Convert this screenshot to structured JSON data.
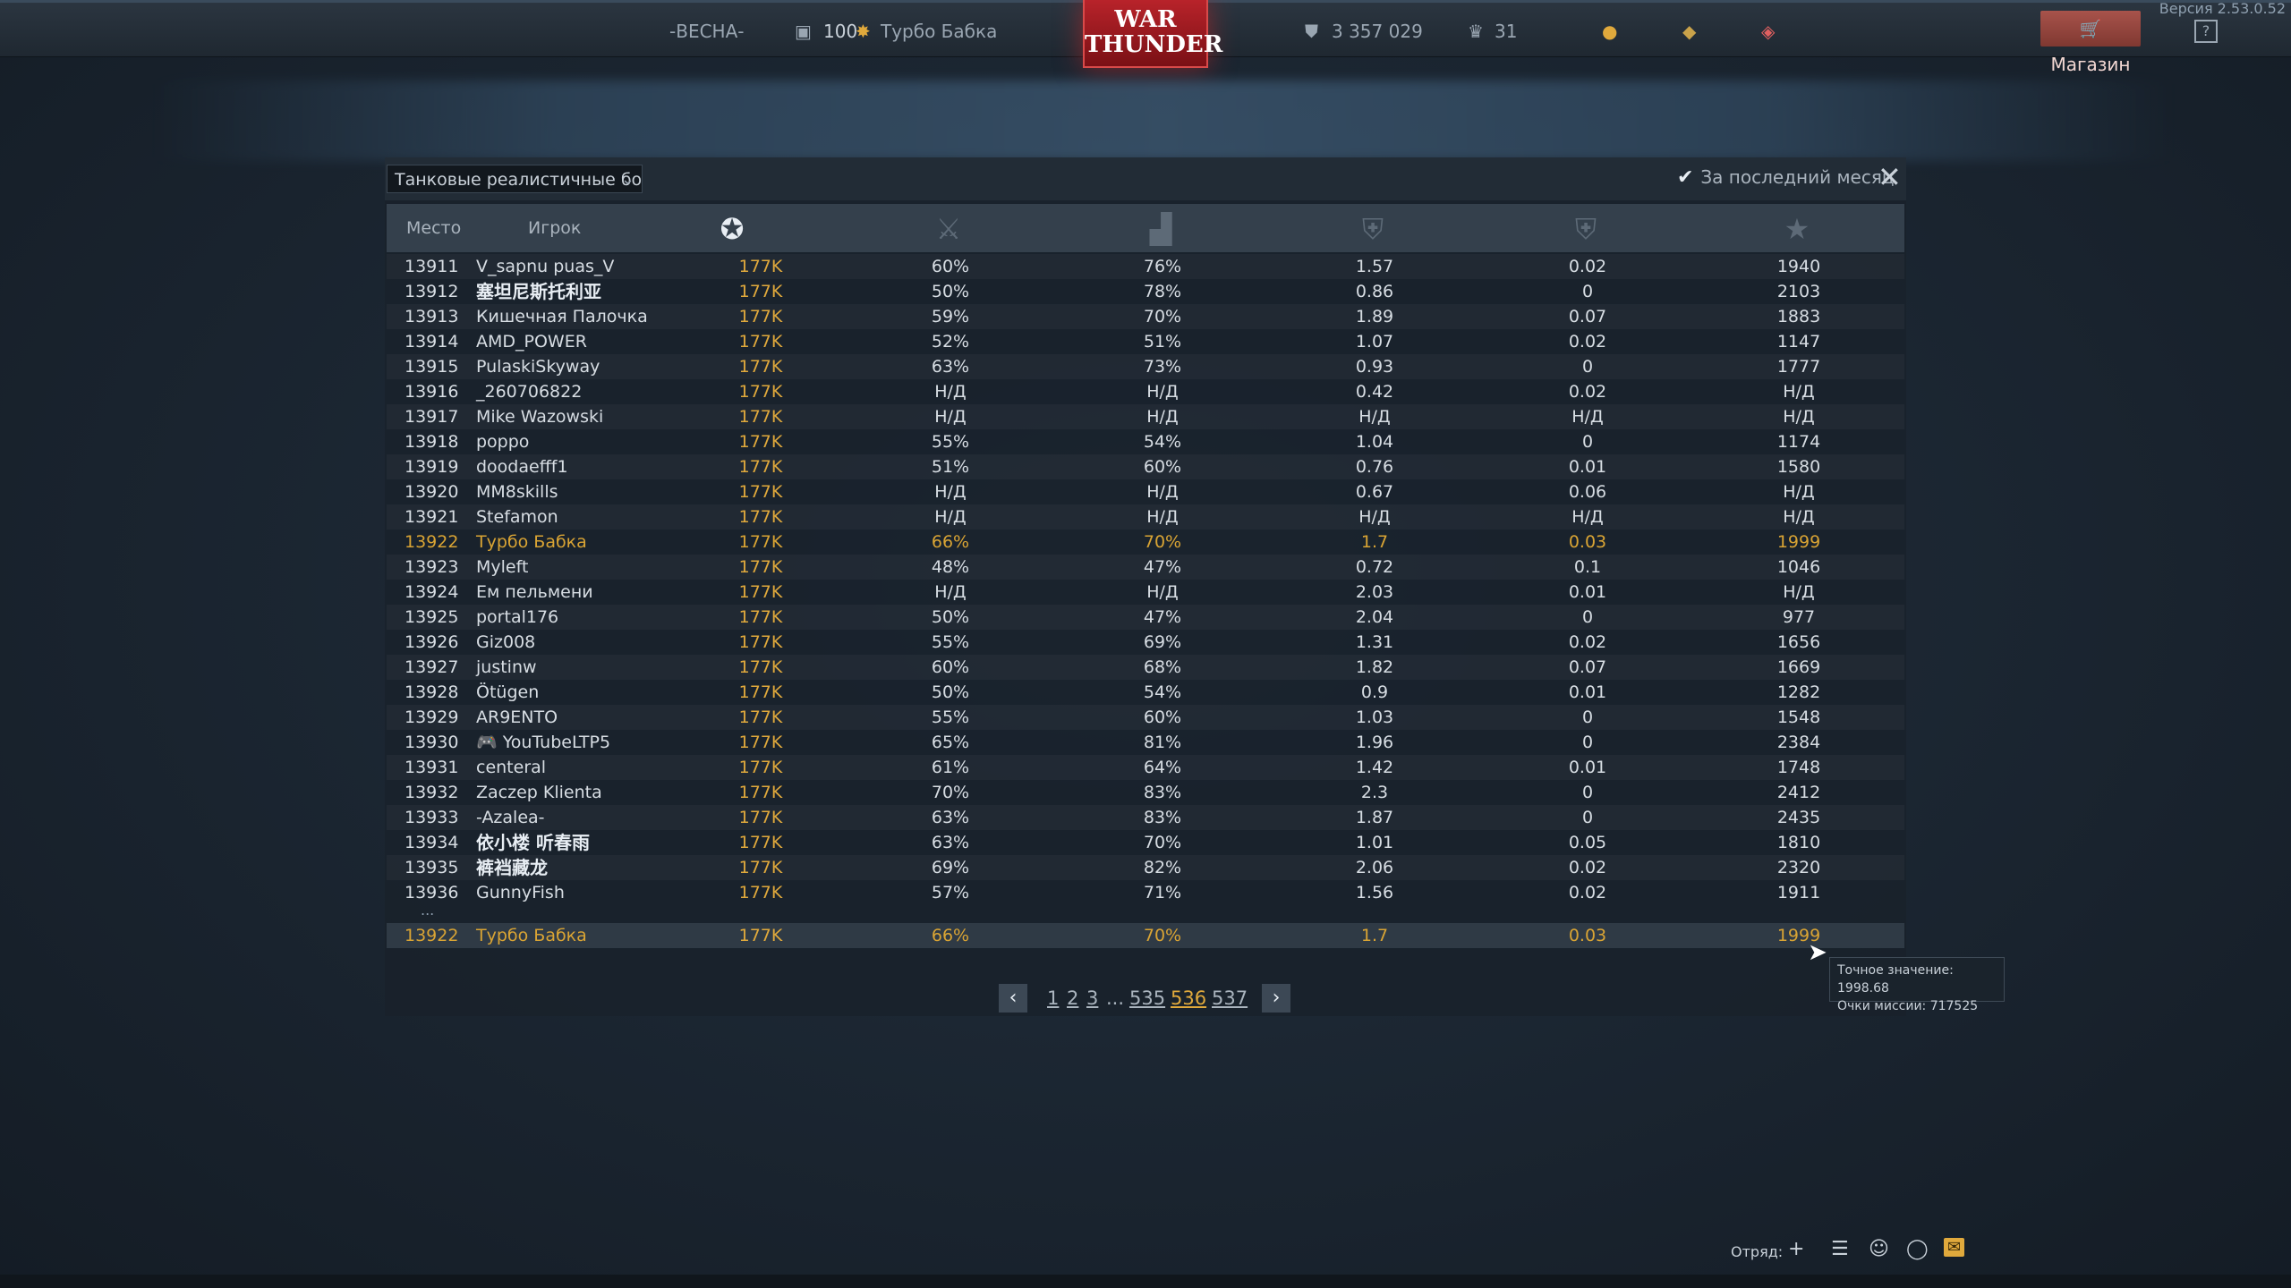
{
  "topbar": {
    "season": "-ВЕСНА-",
    "level": "100",
    "player_name": "Турбо  Бабка",
    "logo_line1": "WAR",
    "logo_line2": "THUNDER",
    "silver_lions": "3 357 029",
    "golden_eagles": "31",
    "shop_label": "Магазин",
    "help_label": "?",
    "version": "Версия 2.53.0.52"
  },
  "leaderboard": {
    "mode_select": "Танковые реалистичные бои",
    "last_month_label": "За последний месяц",
    "columns": {
      "place": "Место",
      "player": "Игрок"
    },
    "rows": [
      {
        "rank": "13911",
        "name": "V_sapnu puas_V",
        "rating": "177K",
        "v1": "60%",
        "v2": "76%",
        "v3": "1.57",
        "v4": "0.02",
        "v5": "1940"
      },
      {
        "rank": "13912",
        "name": "塞坦尼斯托利亚",
        "rating": "177K",
        "v1": "50%",
        "v2": "78%",
        "v3": "0.86",
        "v4": "0",
        "v5": "2103",
        "cjk": true
      },
      {
        "rank": "13913",
        "name": "Кишечная Палочка",
        "rating": "177K",
        "v1": "59%",
        "v2": "70%",
        "v3": "1.89",
        "v4": "0.07",
        "v5": "1883"
      },
      {
        "rank": "13914",
        "name": "AMD_POWER",
        "rating": "177K",
        "v1": "52%",
        "v2": "51%",
        "v3": "1.07",
        "v4": "0.02",
        "v5": "1147"
      },
      {
        "rank": "13915",
        "name": "PulaskiSkyway",
        "rating": "177K",
        "v1": "63%",
        "v2": "73%",
        "v3": "0.93",
        "v4": "0",
        "v5": "1777"
      },
      {
        "rank": "13916",
        "name": "_260706822",
        "rating": "177K",
        "v1": "Н/Д",
        "v2": "Н/Д",
        "v3": "0.42",
        "v4": "0.02",
        "v5": "Н/Д"
      },
      {
        "rank": "13917",
        "name": "Mike Wazowski",
        "rating": "177K",
        "v1": "Н/Д",
        "v2": "Н/Д",
        "v3": "Н/Д",
        "v4": "Н/Д",
        "v5": "Н/Д"
      },
      {
        "rank": "13918",
        "name": "poppo",
        "rating": "177K",
        "v1": "55%",
        "v2": "54%",
        "v3": "1.04",
        "v4": "0",
        "v5": "1174"
      },
      {
        "rank": "13919",
        "name": "doodaefff1",
        "rating": "177K",
        "v1": "51%",
        "v2": "60%",
        "v3": "0.76",
        "v4": "0.01",
        "v5": "1580"
      },
      {
        "rank": "13920",
        "name": "MM8skills",
        "rating": "177K",
        "v1": "Н/Д",
        "v2": "Н/Д",
        "v3": "0.67",
        "v4": "0.06",
        "v5": "Н/Д"
      },
      {
        "rank": "13921",
        "name": "Stefamon",
        "rating": "177K",
        "v1": "Н/Д",
        "v2": "Н/Д",
        "v3": "Н/Д",
        "v4": "Н/Д",
        "v5": "Н/Д"
      },
      {
        "rank": "13922",
        "name": "Турбо  Бабка",
        "rating": "177K",
        "v1": "66%",
        "v2": "70%",
        "v3": "1.7",
        "v4": "0.03",
        "v5": "1999",
        "highlight": true
      },
      {
        "rank": "13923",
        "name": "Myleft",
        "rating": "177K",
        "v1": "48%",
        "v2": "47%",
        "v3": "0.72",
        "v4": "0.1",
        "v5": "1046"
      },
      {
        "rank": "13924",
        "name": "Ем пельмени",
        "rating": "177K",
        "v1": "Н/Д",
        "v2": "Н/Д",
        "v3": "2.03",
        "v4": "0.01",
        "v5": "Н/Д"
      },
      {
        "rank": "13925",
        "name": "portal176",
        "rating": "177K",
        "v1": "50%",
        "v2": "47%",
        "v3": "2.04",
        "v4": "0",
        "v5": "977"
      },
      {
        "rank": "13926",
        "name": "Giz008",
        "rating": "177K",
        "v1": "55%",
        "v2": "69%",
        "v3": "1.31",
        "v4": "0.02",
        "v5": "1656"
      },
      {
        "rank": "13927",
        "name": "justinw",
        "rating": "177K",
        "v1": "60%",
        "v2": "68%",
        "v3": "1.82",
        "v4": "0.07",
        "v5": "1669"
      },
      {
        "rank": "13928",
        "name": "Ötügen",
        "rating": "177K",
        "v1": "50%",
        "v2": "54%",
        "v3": "0.9",
        "v4": "0.01",
        "v5": "1282"
      },
      {
        "rank": "13929",
        "name": "AR9ENTO",
        "rating": "177K",
        "v1": "55%",
        "v2": "60%",
        "v3": "1.03",
        "v4": "0",
        "v5": "1548"
      },
      {
        "rank": "13930",
        "name": "🎮 YouTubeLTP5",
        "rating": "177K",
        "v1": "65%",
        "v2": "81%",
        "v3": "1.96",
        "v4": "0",
        "v5": "2384"
      },
      {
        "rank": "13931",
        "name": "centeral",
        "rating": "177K",
        "v1": "61%",
        "v2": "64%",
        "v3": "1.42",
        "v4": "0.01",
        "v5": "1748"
      },
      {
        "rank": "13932",
        "name": "Zaczep Klienta",
        "rating": "177K",
        "v1": "70%",
        "v2": "83%",
        "v3": "2.3",
        "v4": "0",
        "v5": "2412"
      },
      {
        "rank": "13933",
        "name": "-Azalea-",
        "rating": "177K",
        "v1": "63%",
        "v2": "83%",
        "v3": "1.87",
        "v4": "0",
        "v5": "2435"
      },
      {
        "rank": "13934",
        "name": "依小楼 听春雨",
        "rating": "177K",
        "v1": "63%",
        "v2": "70%",
        "v3": "1.01",
        "v4": "0.05",
        "v5": "1810",
        "cjk": true
      },
      {
        "rank": "13935",
        "name": "裤裆藏龙",
        "rating": "177K",
        "v1": "69%",
        "v2": "82%",
        "v3": "2.06",
        "v4": "0.02",
        "v5": "2320",
        "cjk": true
      },
      {
        "rank": "13936",
        "name": "GunnyFish",
        "rating": "177K",
        "v1": "57%",
        "v2": "71%",
        "v3": "1.56",
        "v4": "0.02",
        "v5": "1911"
      }
    ],
    "ellipsis": "...",
    "self_row": {
      "rank": "13922",
      "name": "Турбо  Бабка",
      "rating": "177K",
      "v1": "66%",
      "v2": "70%",
      "v3": "1.7",
      "v4": "0.03",
      "v5": "1999"
    },
    "pager": {
      "pages": [
        "1",
        "2",
        "3",
        "...",
        "535",
        "536",
        "537"
      ],
      "current": "536"
    },
    "tooltip": {
      "exact": "Точное значение: 1998.68",
      "mission": "Очки миссии: 717525"
    }
  },
  "bottombar": {
    "squad_label": "Отряд:"
  },
  "colors": {
    "accent_gold": "#e0a93c",
    "highlight_row": "#d9a434",
    "shop_bg": "#a8534b",
    "logo_red": "#b8232a"
  }
}
